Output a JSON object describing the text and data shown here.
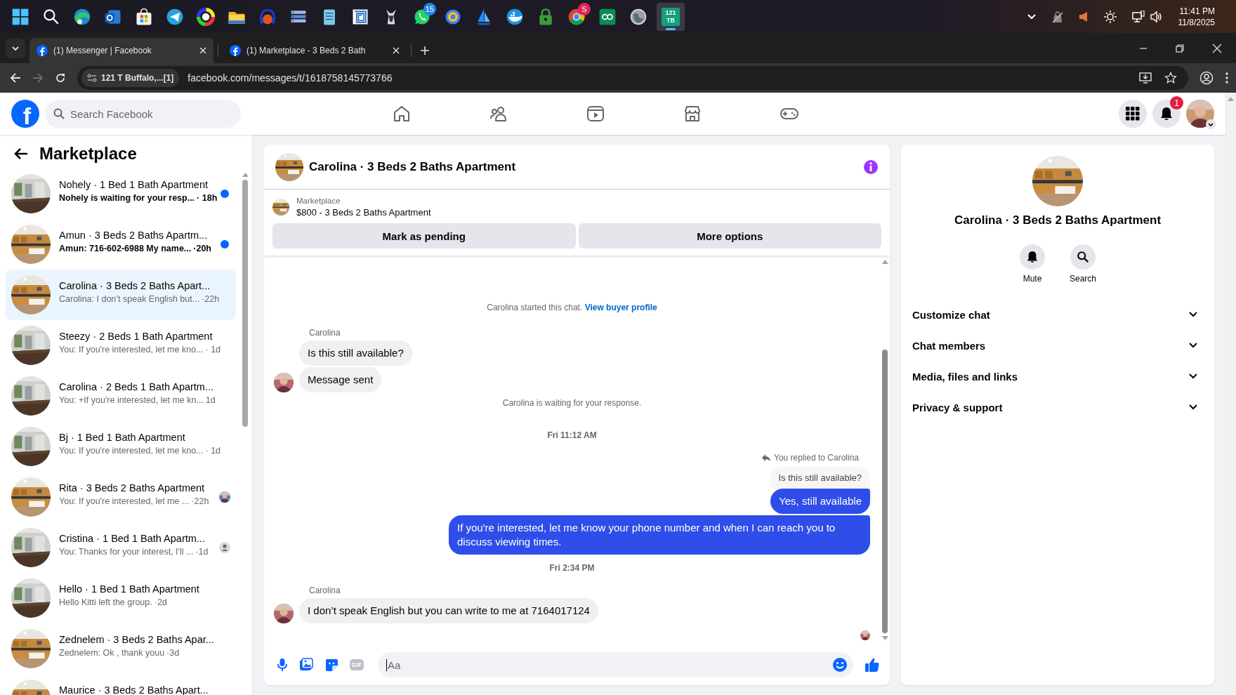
{
  "taskbar": {
    "chat_badge": "15",
    "browser_badge": "S",
    "tile_label": "121 TB",
    "time": "11:41 PM",
    "date": "11/8/2025"
  },
  "browser": {
    "tabs": [
      {
        "title": "(1) Messenger | Facebook",
        "selected": true
      },
      {
        "title": "(1) Marketplace - 3 Beds 2 Bath",
        "selected": false
      }
    ],
    "forward_disabled": true,
    "site_chip": "121 T Buffalo,...[1]",
    "url": "facebook.com/messages/t/1618758145773766"
  },
  "header": {
    "logo": "f",
    "search_placeholder": "Search Facebook",
    "notification_count": "1"
  },
  "sidebar": {
    "title": "Marketplace",
    "conversations": [
      {
        "title": "Nohely · 1 Bed 1 Bath Apartment",
        "preview": "Nohely is waiting for your resp...",
        "time": "· 18h",
        "kind": "unread",
        "selected": false
      },
      {
        "title": "Amun · 3 Beds 2 Baths Apartm...",
        "preview": "Amun: 716-602-6988 My name...",
        "time": "·20h",
        "kind": "unread",
        "selected": false
      },
      {
        "title": "Carolina · 3 Beds 2 Baths Apart...",
        "preview": "Carolina: I don’t speak English but...",
        "time": "·22h",
        "kind": "plain",
        "selected": true
      },
      {
        "title": "Steezy · 2 Beds 1 Bath Apartment",
        "preview": "You: If you're interested, let me kno...",
        "time": "· 1d",
        "kind": "plain",
        "selected": false
      },
      {
        "title": "Carolina · 2 Beds 1 Bath Apartm...",
        "preview": "You: +If you're interested, let me kn...",
        "time": "1d",
        "kind": "plain",
        "selected": false
      },
      {
        "title": "Bj · 1 Bed 1 Bath Apartment",
        "preview": "You: If you're interested, let me kno...",
        "time": "· 1d",
        "kind": "plain",
        "selected": false
      },
      {
        "title": "Rita · 3 Beds 2 Baths Apartment",
        "preview": "You: If you're interested, let me ...",
        "time": "·22h",
        "kind": "seen",
        "selected": false
      },
      {
        "title": "Cristina · 1 Bed 1 Bath Apartm...",
        "preview": "You: Thanks for your interest, I'll ...",
        "time": "·1d",
        "kind": "seen_default",
        "selected": false
      },
      {
        "title": "Hello · 1 Bed 1 Bath Apartment",
        "preview": "Hello Kitti left the group.",
        "time": "·2d",
        "kind": "plain",
        "selected": false
      },
      {
        "title": "Zednelem · 3 Beds 2 Baths Apar...",
        "preview": "Zednelem: Ok , thank youu",
        "time": "·3d",
        "kind": "plain",
        "selected": false
      },
      {
        "title": "Maurice · 3 Beds 2 Baths Apart...",
        "kind": "plain",
        "selected": false
      }
    ]
  },
  "chat": {
    "title": "Carolina · 3 Beds 2 Baths Apartment",
    "listing": {
      "label": "Marketplace",
      "item": "$800 - 3 Beds 2 Baths Apartment"
    },
    "actions": [
      "Mark as pending",
      "More options"
    ],
    "messages": [
      {
        "kind": "system",
        "text": "Carolina started this chat.",
        "link": "View buyer profile"
      },
      {
        "kind": "sender",
        "text": "Carolina"
      },
      {
        "kind": "incoming",
        "text": "Is this still available?",
        "avatar": false
      },
      {
        "kind": "incoming",
        "text": "Message sent",
        "avatar": true
      },
      {
        "kind": "system",
        "text": "Carolina is waiting for your response."
      },
      {
        "kind": "timestamp",
        "text": "Fri 11:12 AM"
      },
      {
        "kind": "reply_note",
        "text": "You replied to Carolina"
      },
      {
        "kind": "quoted",
        "text": "Is this still available?"
      },
      {
        "kind": "outgoing",
        "text": "Yes, still available"
      },
      {
        "kind": "outgoing",
        "text": "If you're interested, let me know your phone number and when I can reach you to discuss viewing times."
      },
      {
        "kind": "timestamp",
        "text": "Fri 2:34 PM"
      },
      {
        "kind": "sender",
        "text": "Carolina"
      },
      {
        "kind": "incoming",
        "text": "I don’t speak English but you can write to me at 7164017124",
        "avatar": true
      },
      {
        "kind": "read_receipt"
      }
    ],
    "composer": {
      "gif_label": "GIF",
      "placeholder": "Aa"
    }
  },
  "info": {
    "title": "Carolina · 3 Beds 2 Baths Apartment",
    "actions": [
      "Mute",
      "Search"
    ],
    "sections": [
      {
        "label": "Customize chat",
        "expanded": false
      },
      {
        "label": "Chat members",
        "expanded": false
      },
      {
        "label": "Media, files and links",
        "expanded": false
      },
      {
        "label": "Privacy & support",
        "expanded": false
      }
    ]
  }
}
